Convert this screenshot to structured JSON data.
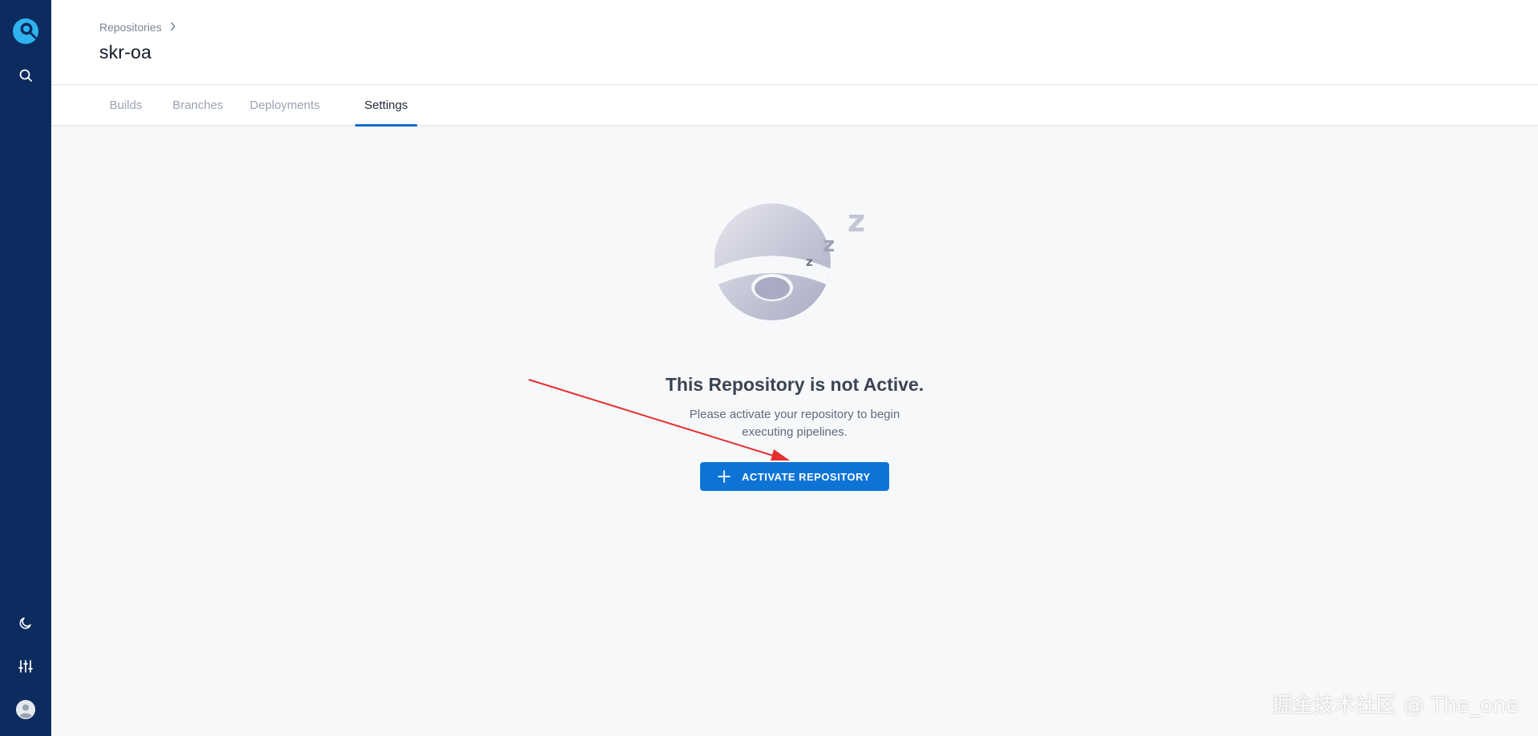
{
  "breadcrumb": {
    "parent": "Repositories"
  },
  "page": {
    "title": "skr-oa"
  },
  "tabs": [
    {
      "label": "Builds",
      "active": false
    },
    {
      "label": "Branches",
      "active": false
    },
    {
      "label": "Deployments",
      "active": false
    },
    {
      "label": "Settings",
      "active": true
    }
  ],
  "sidebar": {
    "icons": [
      "drone-logo-icon",
      "search-icon",
      "moon-icon",
      "sliders-icon",
      "user-avatar-icon"
    ]
  },
  "empty_state": {
    "title": "This Repository is not Active.",
    "description": "Please activate your repository to begin executing pipelines.",
    "button_label": "ACTIVATE REPOSITORY",
    "illustration": "sleeping-logo-zzz"
  },
  "watermark": "掘金技术社区 @ The_one",
  "colors": {
    "sidebar": "#0c2b5e",
    "accent": "#0d74d6",
    "annotation_arrow": "#e53030",
    "background": "#f7f8fa"
  }
}
